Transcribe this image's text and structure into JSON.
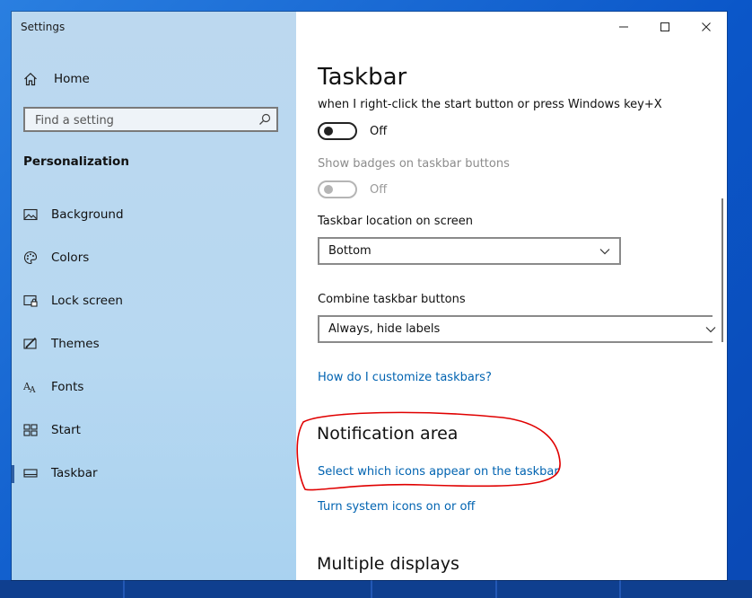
{
  "window": {
    "title": "Settings",
    "controls": {
      "minimize": "minimize",
      "maximize": "maximize",
      "close": "close"
    }
  },
  "sidebar": {
    "home_label": "Home",
    "search_placeholder": "Find a setting",
    "section_title": "Personalization",
    "items": [
      {
        "label": "Background",
        "icon": "image-icon"
      },
      {
        "label": "Colors",
        "icon": "palette-icon"
      },
      {
        "label": "Lock screen",
        "icon": "lock-screen-icon"
      },
      {
        "label": "Themes",
        "icon": "themes-icon"
      },
      {
        "label": "Fonts",
        "icon": "fonts-icon"
      },
      {
        "label": "Start",
        "icon": "start-icon"
      },
      {
        "label": "Taskbar",
        "icon": "taskbar-icon",
        "active": true
      }
    ]
  },
  "main": {
    "title": "Taskbar",
    "powershell_desc": "when I right-click the start button or press Windows key+X",
    "powershell_toggle": {
      "state_label": "Off",
      "enabled": true
    },
    "badges_label": "Show badges on taskbar buttons",
    "badges_toggle": {
      "state_label": "Off",
      "enabled": false
    },
    "location_label": "Taskbar location on screen",
    "location_value": "Bottom",
    "combine_label": "Combine taskbar buttons",
    "combine_value": "Always, hide labels",
    "customize_link": "How do I customize taskbars?",
    "notification_heading": "Notification area",
    "select_icons_link": "Select which icons appear on the taskbar",
    "system_icons_link": "Turn system icons on or off",
    "multiple_displays_heading": "Multiple displays"
  },
  "colors": {
    "accent_link": "#0063b1",
    "annotation": "#e00000",
    "active_indicator": "#2f5fa3"
  }
}
